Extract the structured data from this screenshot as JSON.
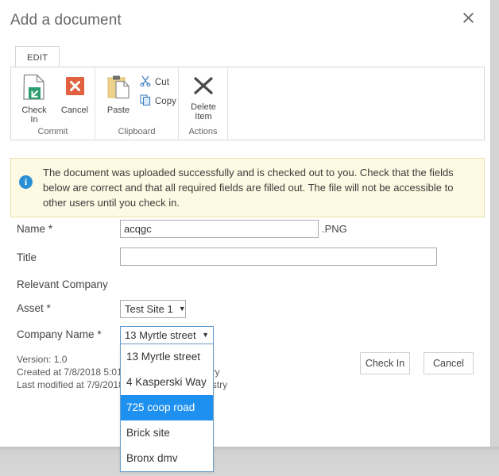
{
  "dialog": {
    "title": "Add a document",
    "close_icon": "close-icon"
  },
  "ribbon": {
    "tabs": [
      {
        "label": "EDIT",
        "active": true
      }
    ],
    "groups": [
      {
        "name": "Commit",
        "label": "Commit",
        "items": [
          {
            "label": "Check\nIn",
            "icon": "check-in-icon"
          },
          {
            "label": "Cancel",
            "icon": "cancel-icon"
          }
        ]
      },
      {
        "name": "Clipboard",
        "label": "Clipboard",
        "items": [
          {
            "label": "Paste",
            "icon": "paste-icon"
          },
          {
            "label": "Cut",
            "icon": "cut-icon"
          },
          {
            "label": "Copy",
            "icon": "copy-icon"
          }
        ]
      },
      {
        "name": "Actions",
        "label": "Actions",
        "items": [
          {
            "label": "Delete\nItem",
            "icon": "delete-item-icon"
          }
        ]
      }
    ],
    "commit_check_in_line1": "Check",
    "commit_check_in_line2": "In",
    "commit_cancel": "Cancel",
    "clipboard_paste": "Paste",
    "clipboard_cut": "Cut",
    "clipboard_copy": "Copy",
    "actions_delete_line1": "Delete",
    "actions_delete_line2": "Item",
    "group_label_commit": "Commit",
    "group_label_clipboard": "Clipboard",
    "group_label_actions": "Actions"
  },
  "notice": {
    "icon": "info-icon",
    "icon_glyph": "i",
    "text": "The document was uploaded successfully and is checked out to you. Check that the fields below are correct and that all required fields are filled out. The file will not be accessible to other users until you check in.",
    "background_color": "#fdf9e2",
    "border_color": "#e9e2ae"
  },
  "form": {
    "name": {
      "label": "Name",
      "required_marker": "*",
      "value": "acqgc",
      "placeholder": "",
      "extension": ".PNG"
    },
    "title": {
      "label": "Title",
      "value": "",
      "placeholder": ""
    },
    "relevant_company": {
      "label": "Relevant Company"
    },
    "asset": {
      "label": "Asset",
      "required_marker": "*",
      "value": "Test Site 1",
      "caret": "▼"
    },
    "company_name": {
      "label": "Company Name",
      "required_marker": "*",
      "value": "13 Myrtle street",
      "caret": "▼",
      "open": true,
      "options": [
        {
          "label": "13 Myrtle street",
          "selected": false
        },
        {
          "label": "4 Kasperski Way",
          "selected": false
        },
        {
          "label": "725 coop road",
          "selected": true
        },
        {
          "label": "Brick site",
          "selected": false
        },
        {
          "label": "Bronx dmv",
          "selected": false
        }
      ],
      "highlight_color": "#1e90ef"
    }
  },
  "meta": {
    "version_line": "Version: 1.0",
    "created_line": "Created at 7/8/2018 5:01",
    "created_line_tail": "try",
    "modified_line": "Last modified at 7/9/2018",
    "modified_line_tail": "g Mistry"
  },
  "actions": {
    "check_in": "Check In",
    "cancel": "Cancel"
  }
}
